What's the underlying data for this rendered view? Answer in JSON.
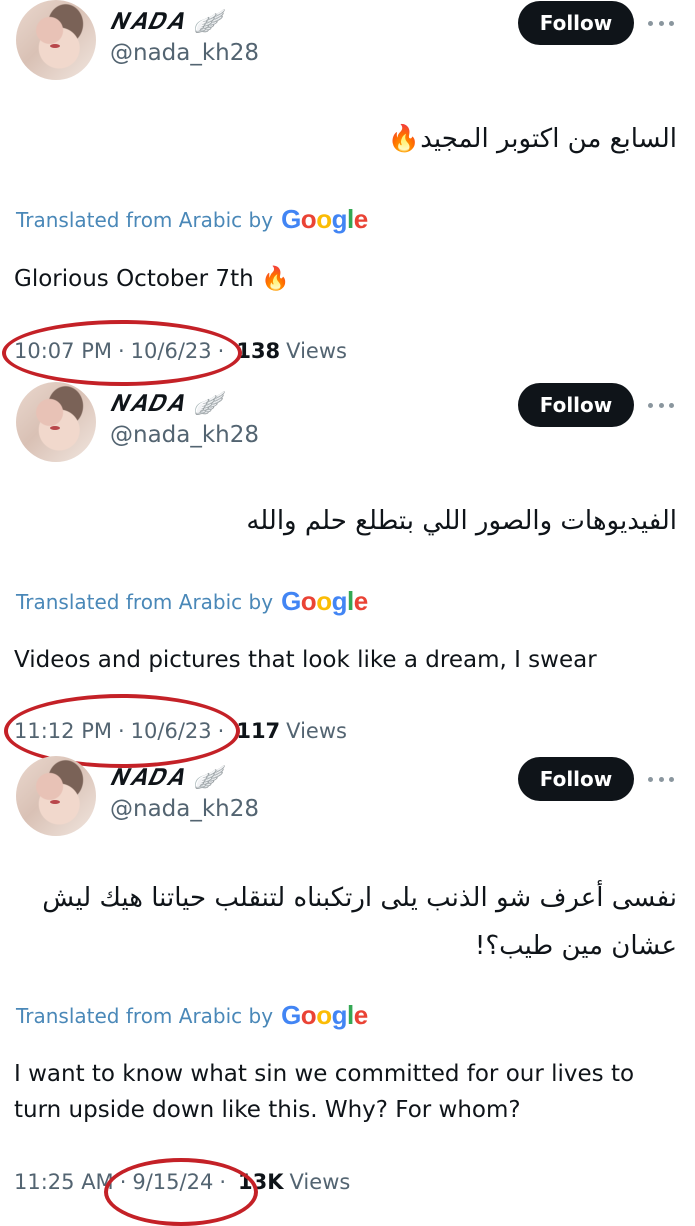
{
  "tweets": [
    {
      "display_name": "𝑵𝑨𝑫𝑨 🪽",
      "handle": "@nada_kh28",
      "follow_label": "Follow",
      "arabic_text": "السابع من اكتوبر المجيد🔥",
      "translated_label": "Translated from Arabic by",
      "google_label": "Google",
      "english_text": "Glorious October 7th 🔥",
      "time": "10:07 PM",
      "date": "10/6/23",
      "views_count": "138",
      "views_label": "Views"
    },
    {
      "display_name": "𝑵𝑨𝑫𝑨 🪽",
      "handle": "@nada_kh28",
      "follow_label": "Follow",
      "arabic_text": "الفيديوهات والصور اللي بتطلع حلم والله",
      "translated_label": "Translated from Arabic by",
      "google_label": "Google",
      "english_text": "Videos and pictures that look like a dream, I swear",
      "time": "11:12 PM",
      "date": "10/6/23",
      "views_count": "117",
      "views_label": "Views"
    },
    {
      "display_name": "𝑵𝑨𝑫𝑨 🪽",
      "handle": "@nada_kh28",
      "follow_label": "Follow",
      "arabic_text": "نفسى أعرف شو الذنب يلى ارتكبناه لتنقلب حياتنا هيك ليش عشان مين طيب؟!",
      "translated_label": "Translated from Arabic by",
      "google_label": "Google",
      "english_text": "I want to know what sin we committed for our lives to turn upside down like this. Why? For whom?",
      "time": "11:25 AM",
      "date": "9/15/24",
      "views_count": "13K",
      "views_label": "Views"
    }
  ],
  "colors": {
    "follow_bg": "#0f1419",
    "translated_blue": "#4a88b8",
    "annotation_red": "#c42127",
    "google_blue": "#4285f4",
    "google_red": "#ea4335",
    "google_yellow": "#fbbc05",
    "google_green": "#34a853"
  }
}
